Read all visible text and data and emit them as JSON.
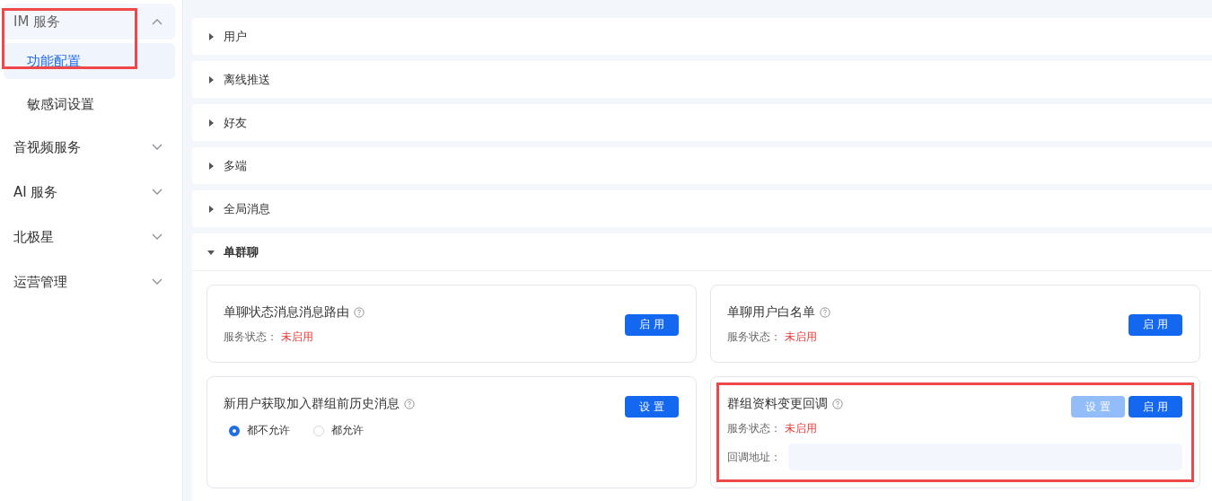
{
  "sidebar": {
    "highlighted": true,
    "groups": [
      {
        "label": "IM 服务",
        "expanded": true,
        "children": [
          {
            "label": "功能配置",
            "selected": true
          },
          {
            "label": "敏感词设置",
            "selected": false
          }
        ]
      },
      {
        "label": "音视频服务",
        "expanded": false
      },
      {
        "label": "AI 服务",
        "expanded": false
      },
      {
        "label": "北极星",
        "expanded": false
      },
      {
        "label": "运营管理",
        "expanded": false
      }
    ]
  },
  "sections": [
    {
      "title": "用户",
      "expanded": false
    },
    {
      "title": "离线推送",
      "expanded": false
    },
    {
      "title": "好友",
      "expanded": false
    },
    {
      "title": "多端",
      "expanded": false
    },
    {
      "title": "全局消息",
      "expanded": false
    },
    {
      "title": "单群聊",
      "expanded": true,
      "cards": [
        {
          "kind": "status",
          "title": "单聊状态消息消息路由",
          "status_label": "服务状态：",
          "status": "未启用",
          "highlighted": false,
          "buttons": [
            {
              "label": "启 用",
              "disabled": false
            }
          ]
        },
        {
          "kind": "status",
          "title": "单聊用户白名单",
          "status_label": "服务状态：",
          "status": "未启用",
          "highlighted": false,
          "buttons": [
            {
              "label": "启 用",
              "disabled": false
            }
          ]
        },
        {
          "kind": "radio",
          "title": "新用户获取加入群组前历史消息",
          "highlighted": false,
          "options": [
            {
              "label": "都不允许",
              "selected": true
            },
            {
              "label": "都允许",
              "selected": false
            }
          ],
          "buttons": [
            {
              "label": "设 置",
              "disabled": false
            }
          ]
        },
        {
          "kind": "callback",
          "title": "群组资料变更回调",
          "status_label": "服务状态：",
          "status": "未启用",
          "field_label": "回调地址：",
          "highlighted": true,
          "buttons": [
            {
              "label": "设 置",
              "disabled": true
            },
            {
              "label": "启 用",
              "disabled": false
            }
          ]
        }
      ]
    }
  ]
}
